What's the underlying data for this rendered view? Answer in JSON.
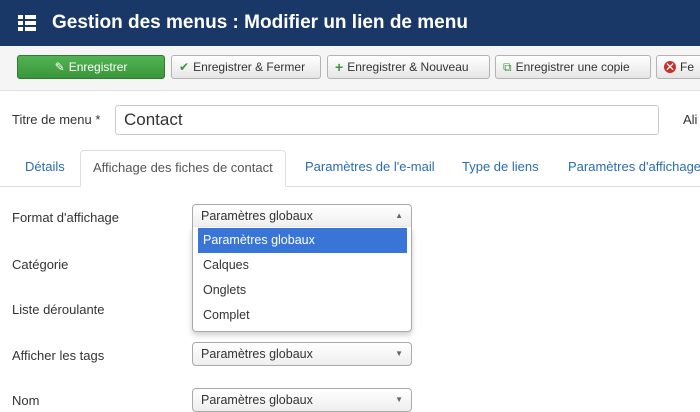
{
  "header": {
    "title": "Gestion des menus : Modifier un lien de menu",
    "icon": "menu-grid-icon"
  },
  "toolbar": {
    "save": "Enregistrer",
    "save_close": "Enregistrer & Fermer",
    "save_new": "Enregistrer & Nouveau",
    "save_copy": "Enregistrer une copie",
    "cancel": "Fe"
  },
  "form": {
    "title_label": "Titre de menu *",
    "title_value": "Contact",
    "alias_label": "Ali"
  },
  "tabs": [
    {
      "label": "Détails",
      "active": false
    },
    {
      "label": "Affichage des fiches de contact",
      "active": true
    },
    {
      "label": "Paramètres de l'e-mail",
      "active": false
    },
    {
      "label": "Type de liens",
      "active": false
    },
    {
      "label": "Paramètres d'affichage",
      "active": false
    }
  ],
  "fields": {
    "format": {
      "label": "Format d'affichage",
      "value": "Paramètres globaux"
    },
    "categorie": {
      "label": "Catégorie"
    },
    "liste": {
      "label": "Liste déroulante"
    },
    "tags": {
      "label": "Afficher les tags",
      "value": "Paramètres globaux"
    },
    "nom": {
      "label": "Nom",
      "value": "Paramètres globaux"
    }
  },
  "dropdown": {
    "options": [
      "Paramètres globaux",
      "Calques",
      "Onglets",
      "Complet"
    ],
    "highlighted_index": 0
  },
  "colors": {
    "header_bg": "#1a3867",
    "save_green": "#46a546",
    "link_blue": "#2a6cb0",
    "highlight": "#3875d7"
  }
}
